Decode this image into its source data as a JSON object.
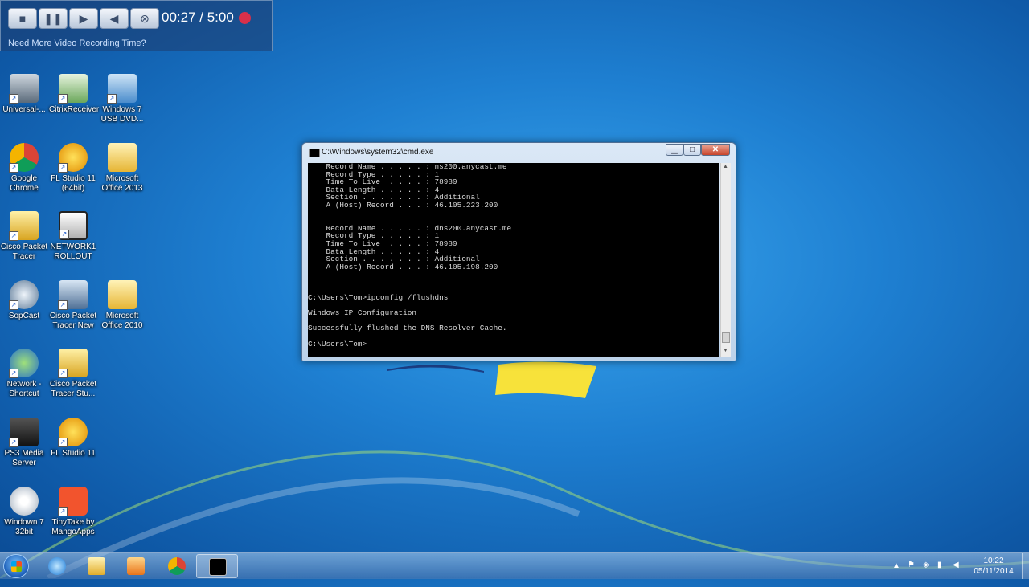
{
  "recorder": {
    "time": "00:27 / 5:00",
    "link": "Need More Video Recording Time?",
    "buttons": [
      "pause-icon",
      "play-icon",
      "volume-icon",
      "cancel-icon"
    ]
  },
  "desktop_icons": [
    {
      "label": "Universal-...",
      "icon": "computer-icon"
    },
    {
      "label": "CitrixReceiver",
      "icon": "citrix-icon"
    },
    {
      "label": "Windows 7 USB DVD...",
      "icon": "usb-dvd-icon"
    },
    {
      "label": "Google Chrome",
      "icon": "chrome-icon"
    },
    {
      "label": "FL Studio 11 (64bit)",
      "icon": "fl-studio-icon"
    },
    {
      "label": "Microsoft Office 2013",
      "icon": "folder-icon"
    },
    {
      "label": "Cisco Packet Tracer",
      "icon": "packet-tracer-icon"
    },
    {
      "label": "NETWORK1 ROLLOUT",
      "icon": "network-rollout-icon"
    },
    {
      "label": "SopCast",
      "icon": "sopcast-icon"
    },
    {
      "label": "Cisco Packet Tracer New",
      "icon": "packet-tracer-icon"
    },
    {
      "label": "Microsoft Office 2010",
      "icon": "folder-icon"
    },
    {
      "label": "Network - Shortcut",
      "icon": "network-icon"
    },
    {
      "label": "Cisco Packet Tracer Stu...",
      "icon": "packet-tracer-icon"
    },
    {
      "label": "PS3 Media Server",
      "icon": "ps3-icon"
    },
    {
      "label": "FL Studio 11",
      "icon": "fl-studio-icon"
    },
    {
      "label": "Windown 7 32bit",
      "icon": "disc-icon"
    },
    {
      "label": "TinyTake by MangoApps",
      "icon": "tinytake-icon"
    }
  ],
  "cmd": {
    "title": "C:\\Windows\\system32\\cmd.exe",
    "lines": [
      "    Record Name . . . . . : ns200.anycast.me",
      "    Record Type . . . . . : 1",
      "    Time To Live  . . . . : 78989",
      "    Data Length . . . . . : 4",
      "    Section . . . . . . . : Additional",
      "    A (Host) Record . . . : 46.105.223.200",
      "",
      "",
      "    Record Name . . . . . : dns200.anycast.me",
      "    Record Type . . . . . : 1",
      "    Time To Live  . . . . : 78989",
      "    Data Length . . . . . : 4",
      "    Section . . . . . . . : Additional",
      "    A (Host) Record . . . : 46.105.198.200",
      "",
      "",
      "",
      "C:\\Users\\Tom>ipconfig /flushdns",
      "",
      "Windows IP Configuration",
      "",
      "Successfully flushed the DNS Resolver Cache.",
      "",
      "C:\\Users\\Tom>"
    ],
    "buttons": {
      "minimize": "▁",
      "maximize": "□",
      "close": "✕"
    }
  },
  "taskbar": {
    "items": [
      "ie-icon",
      "explorer-icon",
      "media-player-icon",
      "chrome-icon",
      "cmd-icon"
    ],
    "active": "cmd-icon",
    "clock_time": "10:22",
    "clock_date": "05/11/2014"
  },
  "colors": {
    "console_bg": "#000000",
    "console_fg": "#d8d8d8",
    "desktop": "#1e7fd1",
    "record": "#d9304a"
  }
}
